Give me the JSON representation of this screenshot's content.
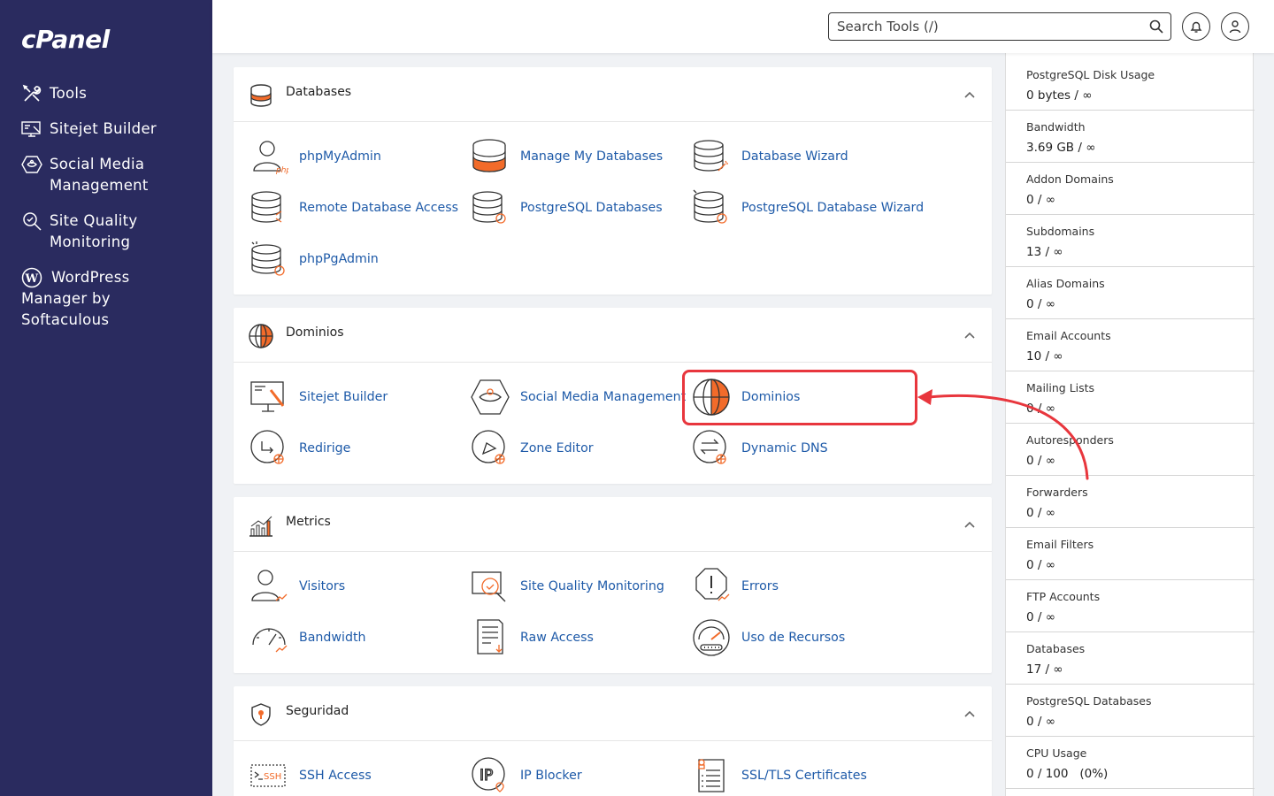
{
  "sidebar": {
    "logo": "cPanel",
    "items": [
      {
        "label": "Tools",
        "icon": "tools-icon"
      },
      {
        "label": "Sitejet Builder",
        "icon": "sitejet-icon"
      },
      {
        "label": "Social Media Management",
        "icon": "social-media-icon"
      },
      {
        "label": "Site Quality Monitoring",
        "icon": "site-quality-icon"
      },
      {
        "label": "WordPress Manager by Softaculous",
        "icon": "wordpress-icon"
      }
    ]
  },
  "header": {
    "search_placeholder": "Search Tools (/)",
    "icons": [
      "search-icon",
      "bell-icon",
      "user-icon"
    ]
  },
  "panels": [
    {
      "title": "Databases",
      "icon": "database-icon",
      "tools": [
        {
          "label": "phpMyAdmin",
          "icon": "phpmyadmin-icon"
        },
        {
          "label": "Manage My Databases",
          "icon": "manage-databases-icon"
        },
        {
          "label": "Database Wizard",
          "icon": "database-wizard-icon"
        },
        {
          "label": "Remote Database Access",
          "icon": "remote-database-icon"
        },
        {
          "label": "PostgreSQL Databases",
          "icon": "postgresql-databases-icon"
        },
        {
          "label": "PostgreSQL Database Wizard",
          "icon": "postgresql-wizard-icon"
        },
        {
          "label": "phpPgAdmin",
          "icon": "phppgadmin-icon"
        }
      ]
    },
    {
      "title": "Dominios",
      "icon": "globe-icon",
      "tools": [
        {
          "label": "Sitejet Builder",
          "icon": "sitejet-builder-icon"
        },
        {
          "label": "Social Media Management",
          "icon": "social-media-management-icon"
        },
        {
          "label": "Dominios",
          "icon": "domains-globe-icon"
        },
        {
          "label": "Redirige",
          "icon": "redirects-icon"
        },
        {
          "label": "Zone Editor",
          "icon": "zone-editor-icon"
        },
        {
          "label": "Dynamic DNS",
          "icon": "dynamic-dns-icon"
        }
      ]
    },
    {
      "title": "Metrics",
      "icon": "metrics-icon",
      "tools": [
        {
          "label": "Visitors",
          "icon": "visitors-icon"
        },
        {
          "label": "Site Quality Monitoring",
          "icon": "site-quality-monitoring-icon"
        },
        {
          "label": "Errors",
          "icon": "errors-icon"
        },
        {
          "label": "Bandwidth",
          "icon": "bandwidth-icon"
        },
        {
          "label": "Raw Access",
          "icon": "raw-access-icon"
        },
        {
          "label": "Uso de Recursos",
          "icon": "resource-usage-icon"
        }
      ]
    },
    {
      "title": "Seguridad",
      "icon": "security-shield-icon",
      "tools": [
        {
          "label": "SSH Access",
          "icon": "ssh-icon"
        },
        {
          "label": "IP Blocker",
          "icon": "ip-blocker-icon"
        },
        {
          "label": "SSL/TLS Certificates",
          "icon": "ssl-certificates-icon"
        }
      ]
    }
  ],
  "stats": [
    {
      "label": "PostgreSQL Disk Usage",
      "value": "0 bytes / ∞"
    },
    {
      "label": "Bandwidth",
      "value": "3.69 GB / ∞"
    },
    {
      "label": "Addon Domains",
      "value": "0 / ∞"
    },
    {
      "label": "Subdomains",
      "value": "13 / ∞"
    },
    {
      "label": "Alias Domains",
      "value": "0 / ∞"
    },
    {
      "label": "Email Accounts",
      "value": "10 / ∞"
    },
    {
      "label": "Mailing Lists",
      "value": "0 / ∞"
    },
    {
      "label": "Autoresponders",
      "value": "0 / ∞"
    },
    {
      "label": "Forwarders",
      "value": "0 / ∞"
    },
    {
      "label": "Email Filters",
      "value": "0 / ∞"
    },
    {
      "label": "FTP Accounts",
      "value": "0 / ∞"
    },
    {
      "label": "Databases",
      "value": "17 / ∞"
    },
    {
      "label": "PostgreSQL Databases",
      "value": "0 / ∞"
    },
    {
      "label": "CPU Usage",
      "value": "0 / 100   (0%)"
    }
  ],
  "annotation": {
    "color": "#e8363d",
    "target": "Dominios"
  }
}
